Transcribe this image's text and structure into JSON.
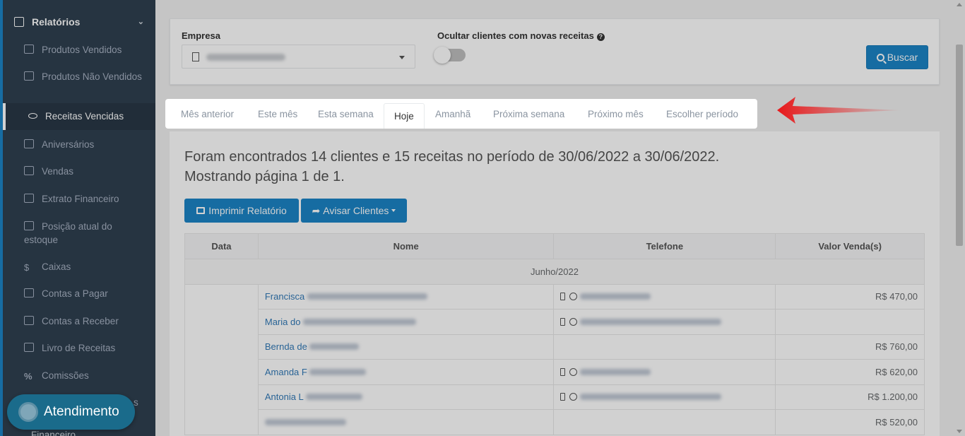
{
  "sidebar": {
    "header": "Relatórios",
    "items": [
      {
        "label": "Produtos Vendidos"
      },
      {
        "label": "Produtos Não Vendidos"
      },
      {
        "label": "Receitas Vencidas"
      },
      {
        "label": "Aniversários"
      },
      {
        "label": "Vendas"
      },
      {
        "label": "Extrato Financeiro"
      },
      {
        "label": "Posição atual do estoque"
      },
      {
        "label": "Caixas"
      },
      {
        "label": "Contas a Pagar"
      },
      {
        "label": "Contas a Receber"
      },
      {
        "label": "Livro de Receitas"
      },
      {
        "label": "Comissões"
      }
    ],
    "partial_item_1": "s",
    "partial_item_2": "Financeiro"
  },
  "filters": {
    "empresa_label": "Empresa",
    "ocultar_label": "Ocultar clientes com novas receitas",
    "help_glyph": "?",
    "buscar_label": "Buscar"
  },
  "tabs": [
    {
      "label": "Mês anterior"
    },
    {
      "label": "Este mês"
    },
    {
      "label": "Esta semana"
    },
    {
      "label": "Hoje"
    },
    {
      "label": "Amanhã"
    },
    {
      "label": "Próxima semana"
    },
    {
      "label": "Próximo mês"
    },
    {
      "label": "Escolher período"
    }
  ],
  "results": {
    "line1": "Foram encontrados 14 clientes e 15 receitas no período de 30/06/2022 a 30/06/2022.",
    "line2": "Mostrando página 1 de 1.",
    "print_label": "Imprimir Relatório",
    "notify_label": "Avisar Clientes"
  },
  "table": {
    "headers": [
      "Data",
      "Nome",
      "Telefone",
      "Valor Venda(s)"
    ],
    "month": "Junho/2022",
    "rows": [
      {
        "name": "Francisca",
        "value": "R$ 470,00"
      },
      {
        "name": "Maria do",
        "value": ""
      },
      {
        "name": "Bernda de",
        "value": "R$ 760,00"
      },
      {
        "name": "Amanda F",
        "value": "R$ 620,00"
      },
      {
        "name": "Antonia L",
        "value": "R$ 1.200,00"
      },
      {
        "name": "",
        "value": "R$ 520,00"
      }
    ]
  },
  "chat": {
    "label": "Atendimento"
  },
  "colors": {
    "primary": "#1c84c6",
    "sidebar": "#2f4050",
    "arrow": "#e8191b"
  }
}
